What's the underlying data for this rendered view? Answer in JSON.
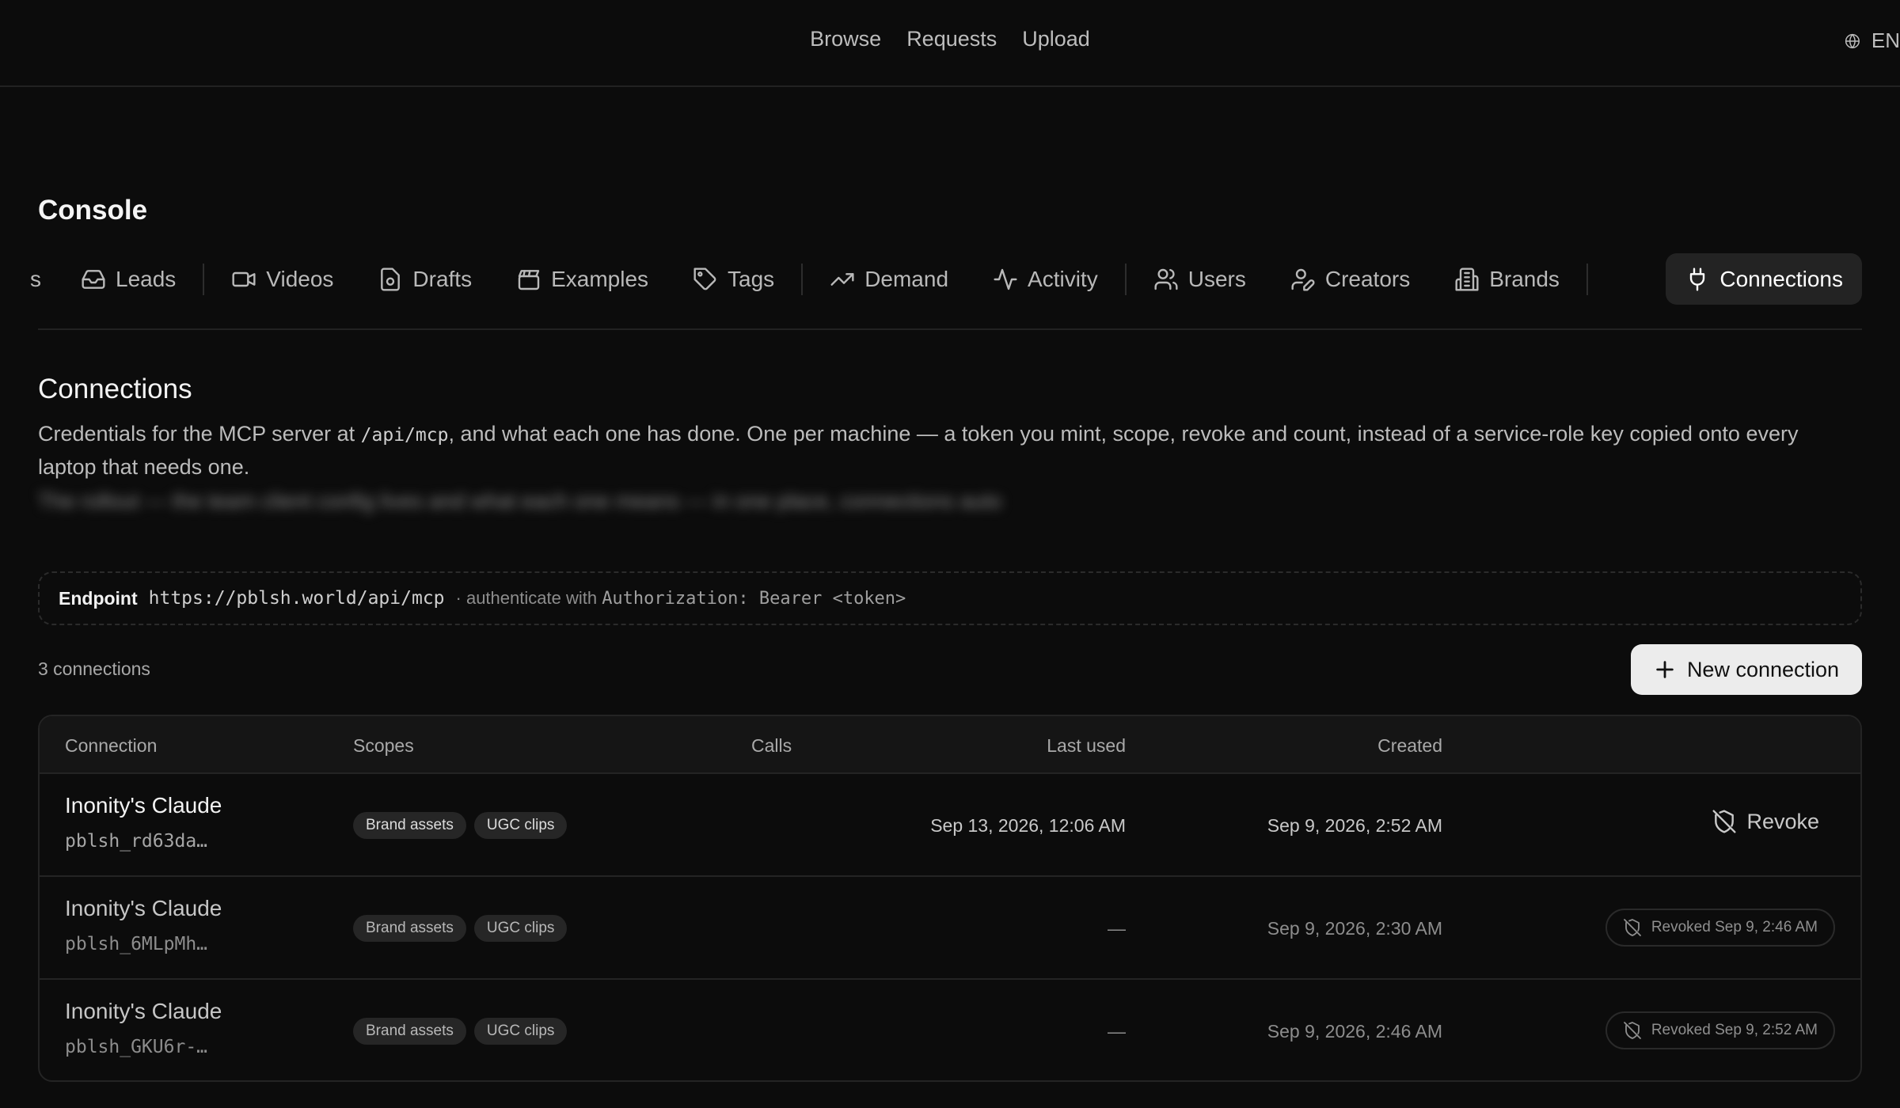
{
  "topnav": {
    "items": [
      "Browse",
      "Requests",
      "Upload"
    ],
    "lang": "EN"
  },
  "console": {
    "title": "Console",
    "subtitle": ""
  },
  "tabs": [
    {
      "label": "s",
      "icon": "none"
    },
    {
      "label": "Leads",
      "icon": "inbox-icon"
    },
    {
      "label": "Videos",
      "icon": "video-icon"
    },
    {
      "label": "Drafts",
      "icon": "draft-icon"
    },
    {
      "label": "Examples",
      "icon": "clapperboard-icon"
    },
    {
      "label": "Tags",
      "icon": "tag-icon"
    },
    {
      "label": "Demand",
      "icon": "trending-up-icon"
    },
    {
      "label": "Activity",
      "icon": "activity-icon"
    },
    {
      "label": "Users",
      "icon": "users-icon"
    },
    {
      "label": "Creators",
      "icon": "user-pen-icon"
    },
    {
      "label": "Brands",
      "icon": "building-icon"
    },
    {
      "label": "Connections",
      "icon": "plug-icon",
      "active": true
    }
  ],
  "section": {
    "title": "Connections",
    "desc_pre": "Credentials for the MCP server at ",
    "desc_code": "/api/mcp",
    "desc_post": ", and what each one has done. One per machine — a token you mint, scope, revoke and count, instead of a service-role key copied onto every laptop that needs one."
  },
  "endpoint": {
    "label": "Endpoint",
    "url": "https://pblsh.world/api/mcp",
    "note_pre": "· authenticate with ",
    "note_code": "Authorization: Bearer <token>"
  },
  "count_label": "3 connections",
  "new_button": "New connection",
  "table": {
    "headers": {
      "connection": "Connection",
      "scopes": "Scopes",
      "calls": "Calls",
      "last_used": "Last used",
      "created": "Created"
    },
    "rows": [
      {
        "name": "Inonity's Claude",
        "token": "pblsh_rd63da…",
        "scopes": [
          "Brand assets",
          "UGC clips"
        ],
        "calls": "",
        "last_used": "Sep 13, 2026, 12:06 AM",
        "created": "Sep 9, 2026, 2:52 AM",
        "action": "Revoke"
      },
      {
        "name": "Inonity's Claude",
        "token": "pblsh_6MLpMh…",
        "scopes": [
          "Brand assets",
          "UGC clips"
        ],
        "calls": "",
        "last_used": "—",
        "created": "Sep 9, 2026, 2:30 AM",
        "status": "Revoked Sep 9, 2:46 AM"
      },
      {
        "name": "Inonity's Claude",
        "token": "pblsh_GKU6r-…",
        "scopes": [
          "Brand assets",
          "UGC clips"
        ],
        "calls": "",
        "last_used": "—",
        "created": "Sep 9, 2026, 2:46 AM",
        "status": "Revoked Sep 9, 2:52 AM"
      }
    ]
  }
}
